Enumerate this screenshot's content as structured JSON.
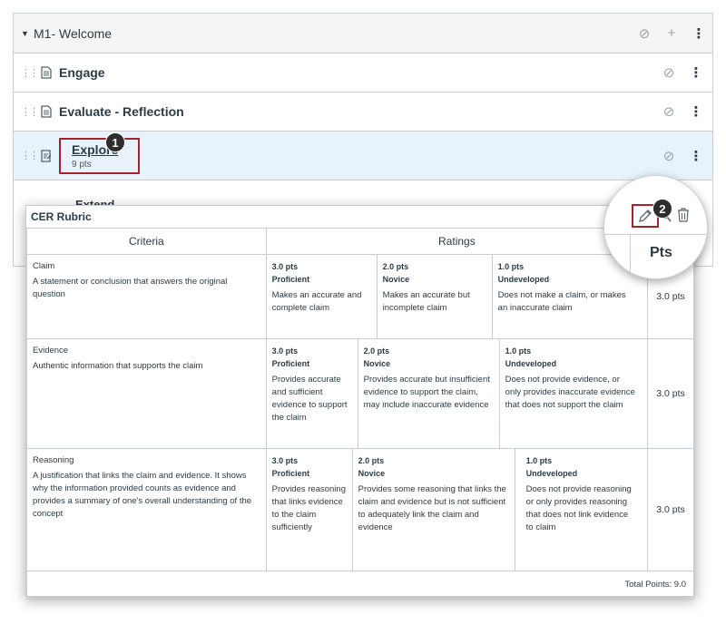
{
  "module": {
    "title": "M1- Welcome",
    "items": [
      {
        "title": "Engage"
      },
      {
        "title": "Evaluate - Reflection"
      },
      {
        "title": "Explore",
        "points": "9 pts"
      },
      {
        "title": "Extend"
      }
    ]
  },
  "callouts": {
    "one": "1",
    "two": "2"
  },
  "icons": {
    "collapse": "caret-down-icon",
    "unpublished": "circle-slash-icon",
    "add": "plus-icon",
    "more": "kebab-icon",
    "drag": "drag-handle-icon",
    "page": "page-icon",
    "assignment": "assignment-icon",
    "edit": "pencil-icon",
    "search": "search-icon",
    "delete": "trash-icon"
  },
  "rubric": {
    "title": "CER Rubric",
    "headers": {
      "criteria": "Criteria",
      "ratings": "Ratings",
      "pts": "Pts"
    },
    "criteria": [
      {
        "name": "Claim",
        "description": "A statement or conclusion that answers the original question",
        "points": "3.0 pts",
        "ratings": [
          {
            "pts": "3.0 pts",
            "label": "Proficient",
            "desc": "Makes an accurate and complete claim"
          },
          {
            "pts": "2.0 pts",
            "label": "Novice",
            "desc": "Makes an accurate but incomplete claim"
          },
          {
            "pts": "1.0 pts",
            "label": "Undeveloped",
            "desc": "Does not make a claim, or makes an inaccurate claim"
          }
        ]
      },
      {
        "name": "Evidence",
        "description": "Authentic information that supports the claim",
        "points": "3.0 pts",
        "ratings": [
          {
            "pts": "3.0 pts",
            "label": "Proficient",
            "desc": "Provides accurate and sufficient evidence to support the claim"
          },
          {
            "pts": "2.0 pts",
            "label": "Novice",
            "desc": "Provides accurate but insufficient evidence to support the claim, may include inaccurate evidence"
          },
          {
            "pts": "1.0 pts",
            "label": "Undeveloped",
            "desc": "Does not provide evidence, or only provides inaccurate evidence that does not support the claim"
          }
        ]
      },
      {
        "name": "Reasoning",
        "description": "A justification that links the claim and evidence. It shows why the information provided counts as evidence and provides a summary of one's overall understanding of the concept",
        "points": "3.0 pts",
        "ratings": [
          {
            "pts": "3.0 pts",
            "label": "Proficient",
            "desc": "Provides reasoning that links evidence to the claim sufficiently"
          },
          {
            "pts": "2.0 pts",
            "label": "Novice",
            "desc": "Provides some reasoning that links the claim and evidence but is not sufficient to adequately link the claim and evidence"
          },
          {
            "pts": "1.0 pts",
            "label": "Undeveloped",
            "desc": "Does not provide reasoning or only provides reasoning that does not link evidence to claim"
          }
        ]
      }
    ],
    "total": "Total Points: 9.0"
  },
  "colors": {
    "highlight": "#a5222d",
    "active_row": "#e8f2fb",
    "text": "#2d3b45",
    "border": "#c7cdd1"
  }
}
